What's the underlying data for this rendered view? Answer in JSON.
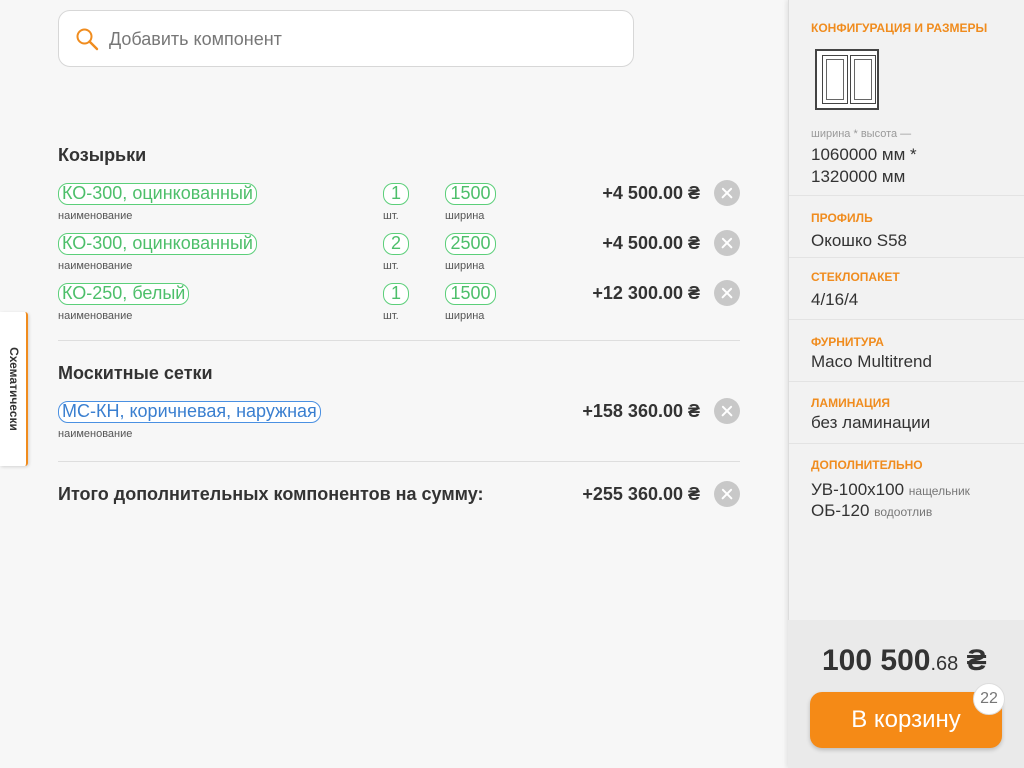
{
  "side_tab": {
    "label": "Схематически"
  },
  "search": {
    "placeholder": "Добавить компонент"
  },
  "sections": [
    {
      "title": "Козырьки",
      "items": [
        {
          "name": "КО-300, оцинкованный",
          "name_caption": "наименование",
          "qty": "1",
          "qty_caption": "шт.",
          "width": "1500",
          "width_caption": "ширина",
          "price": "+4 500.00 ₴"
        },
        {
          "name": "КО-300, оцинкованный",
          "name_caption": "наименование",
          "qty": "2",
          "qty_caption": "шт.",
          "width": "2500",
          "width_caption": "ширина",
          "price": "+4 500.00 ₴"
        },
        {
          "name": "КО-250, белый",
          "name_caption": "наименование",
          "qty": "1",
          "qty_caption": "шт.",
          "width": "1500",
          "width_caption": "ширина",
          "price": "+12 300.00 ₴"
        }
      ]
    },
    {
      "title": "Москитные сетки",
      "items": [
        {
          "name": "МС-КН, коричневая, наружная",
          "name_caption": "наименование",
          "price": "+158 360.00 ₴"
        }
      ]
    }
  ],
  "total": {
    "label": "Итого дополнительных компонентов на сумму:",
    "value": "+255 360.00 ₴"
  },
  "panel": {
    "config": {
      "title": "КОНФИГУРАЦИЯ И РАЗМЕРЫ",
      "dim_caption": "ширина * высота —",
      "dim_line1": "1060000 мм *",
      "dim_line2": "1320000 мм"
    },
    "profile": {
      "title": "ПРОФИЛЬ",
      "value": "Окошко S58"
    },
    "glass": {
      "title": "СТЕКЛОПАКЕТ",
      "value": "4/16/4"
    },
    "hardware": {
      "title": "ФУРНИТУРА",
      "value": "Maco Multitrend"
    },
    "lamination": {
      "title": "ЛАМИНАЦИЯ",
      "value": "без ламинации"
    },
    "extra": {
      "title": "ДОПОЛНИТЕЛЬНО",
      "items": [
        {
          "code": "УВ-100x100",
          "note": "нащельник"
        },
        {
          "code": "ОБ-120",
          "note": "водоотлив"
        }
      ]
    }
  },
  "order": {
    "price_main": "100 500",
    "price_cents": ".68",
    "currency": "₴",
    "cart_label": "В корзину",
    "cart_count": "22"
  },
  "colors": {
    "accent": "#f58a16",
    "green_pill": "#5ccf7a",
    "blue_pill": "#4a90e2"
  }
}
